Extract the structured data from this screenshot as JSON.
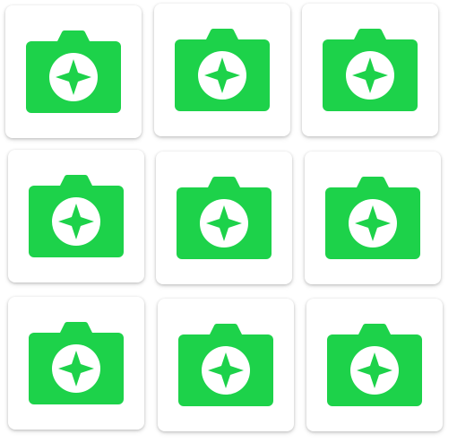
{
  "grid": {
    "rows": 3,
    "columns": 3,
    "tiles": [
      {
        "icon": "camera-compass-icon"
      },
      {
        "icon": "camera-compass-icon"
      },
      {
        "icon": "camera-compass-icon"
      },
      {
        "icon": "camera-compass-icon"
      },
      {
        "icon": "camera-compass-icon"
      },
      {
        "icon": "camera-compass-icon"
      },
      {
        "icon": "camera-compass-icon"
      },
      {
        "icon": "camera-compass-icon"
      },
      {
        "icon": "camera-compass-icon"
      }
    ]
  },
  "colors": {
    "icon_green": "#1DD24A",
    "tile_background": "#FFFFFF",
    "page_background": "#FFFFFF"
  }
}
